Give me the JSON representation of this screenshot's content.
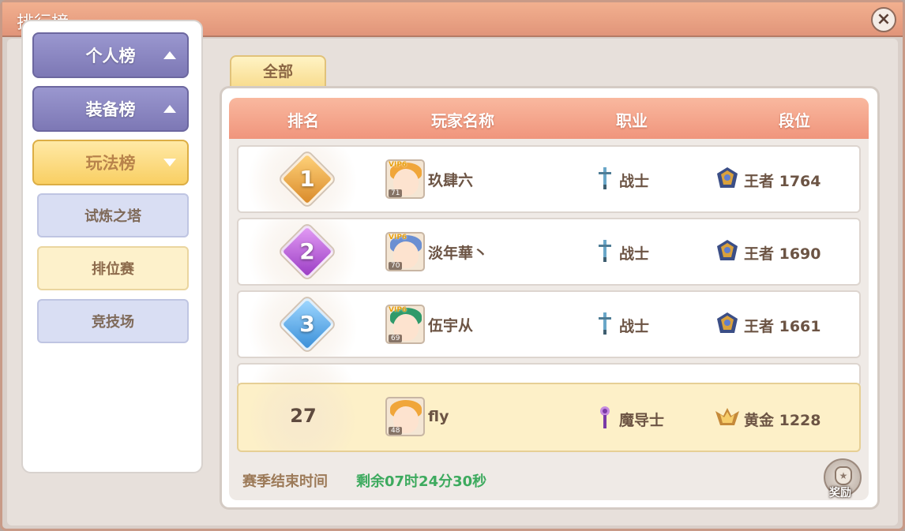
{
  "window": {
    "title": "排行榜"
  },
  "sidebar": {
    "categories": [
      {
        "label": "个人榜",
        "state": "collapsed"
      },
      {
        "label": "装备榜",
        "state": "collapsed"
      },
      {
        "label": "玩法榜",
        "state": "expanded"
      }
    ],
    "sub_items": [
      {
        "label": "试炼之塔",
        "selected": false
      },
      {
        "label": "排位赛",
        "selected": true
      },
      {
        "label": "竞技场",
        "selected": false
      }
    ]
  },
  "tabs": [
    {
      "label": "全部",
      "selected": true
    }
  ],
  "table": {
    "headers": {
      "rank": "排名",
      "player": "玩家名称",
      "class": "职业",
      "tier": "段位"
    },
    "rows": [
      {
        "rank": "1",
        "vip": "VIP6",
        "level": "71",
        "name": "玖肆六",
        "class": "战士",
        "tier": "王者 1764",
        "badge_color": "#e9a23b"
      },
      {
        "rank": "2",
        "vip": "VIP6",
        "level": "70",
        "name": "淡年華丶",
        "class": "战士",
        "tier": "王者 1690",
        "badge_color": "#b34fd6"
      },
      {
        "rank": "3",
        "vip": "VIP6",
        "level": "69",
        "name": "伍宇从",
        "class": "战士",
        "tier": "王者 1661",
        "badge_color": "#4fa7e8"
      }
    ],
    "my_row": {
      "rank": "27",
      "level": "48",
      "name": "fly",
      "class": "魔导士",
      "tier": "黄金 1228"
    }
  },
  "season": {
    "label": "赛季结束时间",
    "remaining": "剩余07时24分30秒"
  },
  "reward": {
    "label": "奖励"
  },
  "colors": {
    "accent": "#f0957c",
    "gold": "#f9cf63",
    "purple": "#7d78b5",
    "green": "#3daa5e"
  }
}
